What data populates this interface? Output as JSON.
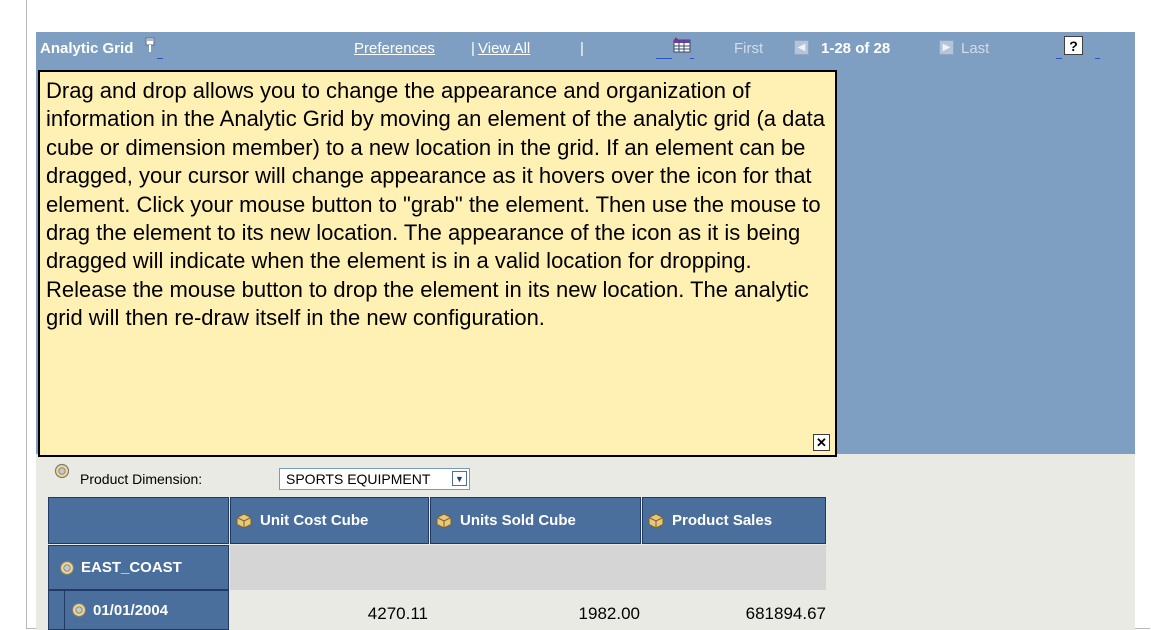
{
  "header": {
    "title": "Analytic Grid",
    "preferences_label": "Preferences",
    "view_all_label": "View All",
    "separator": "|",
    "first_label": "First",
    "range_label": "1-28 of 28",
    "last_label": "Last",
    "help_label": "?"
  },
  "tooltip": {
    "text": "Drag and drop allows you to change the appearance and organization of information in the Analytic Grid by moving an element of the analytic grid (a data cube or dimension member) to a new location in the grid. If an element can be dragged, your cursor will change appearance as it hovers over the icon for that element. Click your mouse button to \"grab\" the element. Then use the mouse to drag the element to its new location. The appearance of the icon as it is being dragged will indicate when the element is in a valid location for dropping. Release the mouse button to drop the element in its new location. The analytic grid will then re-draw itself in the new configuration.",
    "close_label": "✕"
  },
  "dimension": {
    "label": "Product Dimension:",
    "value": "SPORTS EQUIPMENT"
  },
  "table": {
    "columns": [
      "Unit Cost Cube",
      "Units Sold Cube",
      "Product Sales"
    ],
    "groups": [
      {
        "name": "EAST_COAST",
        "rows": [
          {
            "label": "01/01/2004",
            "values": [
              "4270.11",
              "1982.00",
              "681894.67"
            ]
          }
        ]
      }
    ]
  },
  "colors": {
    "header_bg": "#7f9fc2",
    "tooltip_bg": "#fff0b4",
    "grid_header": "#4a6f9d",
    "panel_bg": "#e9eae4"
  }
}
